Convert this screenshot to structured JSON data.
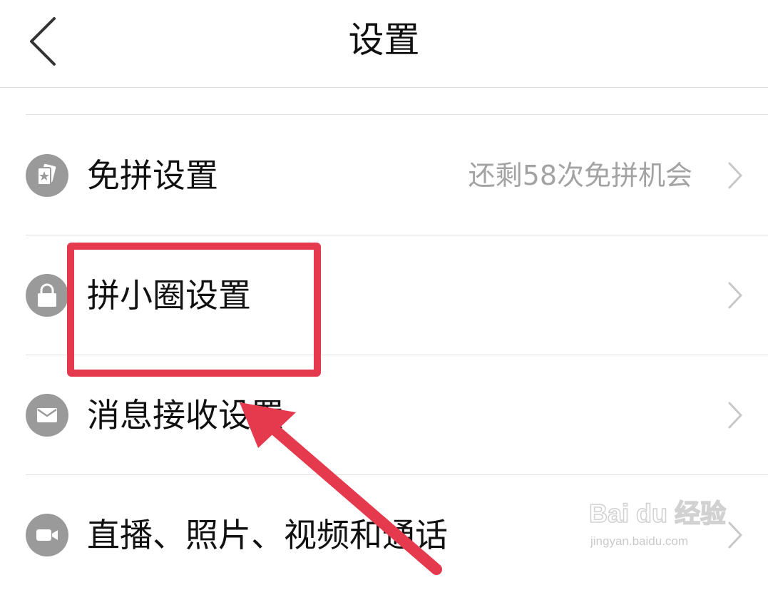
{
  "header": {
    "title": "设置",
    "back_icon": "chevron-left-icon"
  },
  "rows": [
    {
      "label": "免拼设置",
      "value": "还剩58次免拼机会",
      "icon": "card-star-icon"
    },
    {
      "label": "拼小圈设置",
      "icon": "lock-icon"
    },
    {
      "label": "消息接收设置",
      "icon": "envelope-icon"
    },
    {
      "label": "直播、照片、视频和通话",
      "icon": "video-camera-icon"
    }
  ],
  "annotation": {
    "color": "#e53a4e"
  },
  "watermark": {
    "logo": "Bai du 经验",
    "url": "jingyan.baidu.com"
  },
  "colors": {
    "text_primary": "#111111",
    "text_secondary": "#a3a3a3",
    "icon_bg": "#9a9a9a",
    "divider": "#e2e2e2"
  }
}
